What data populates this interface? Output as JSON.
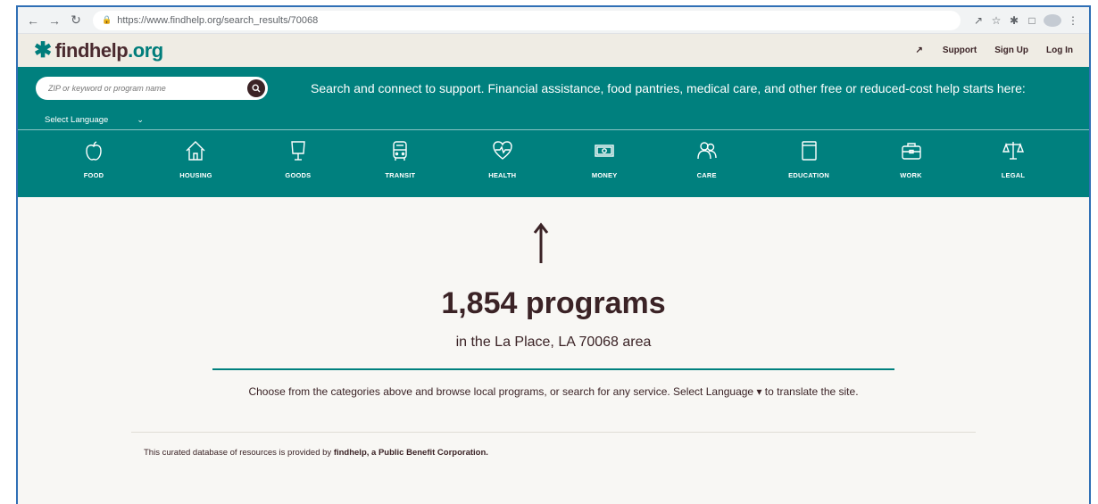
{
  "browser": {
    "url": "https://www.findhelp.org/search_results/70068"
  },
  "header": {
    "logo_main": "findhelp",
    "logo_tld": ".org",
    "support": "Support",
    "signup": "Sign Up",
    "login": "Log In"
  },
  "search": {
    "placeholder": "ZIP or keyword or program name",
    "tagline": "Search and connect to support. Financial assistance, food pantries, medical care, and other free or reduced-cost help starts here:",
    "language_label": "Select Language"
  },
  "categories": [
    {
      "label": "FOOD",
      "icon": "apple-icon"
    },
    {
      "label": "HOUSING",
      "icon": "house-icon"
    },
    {
      "label": "GOODS",
      "icon": "lamp-icon"
    },
    {
      "label": "TRANSIT",
      "icon": "bus-icon"
    },
    {
      "label": "HEALTH",
      "icon": "heart-icon"
    },
    {
      "label": "MONEY",
      "icon": "money-icon"
    },
    {
      "label": "CARE",
      "icon": "people-icon"
    },
    {
      "label": "EDUCATION",
      "icon": "book-icon"
    },
    {
      "label": "WORK",
      "icon": "briefcase-icon"
    },
    {
      "label": "LEGAL",
      "icon": "scales-icon"
    }
  ],
  "results": {
    "count": "1,854 programs",
    "area": "in the La Place, LA 70068 area",
    "instruction": "Choose from the categories above and browse local programs, or search for any service. Select Language ▾ to translate the site."
  },
  "footer": {
    "provider_prefix": "This curated database of resources is provided by ",
    "provider_name": "findhelp, a Public Benefit Corporation."
  },
  "colors": {
    "teal": "#00807e",
    "dark_brown": "#3b2326",
    "cream": "#efece4"
  }
}
